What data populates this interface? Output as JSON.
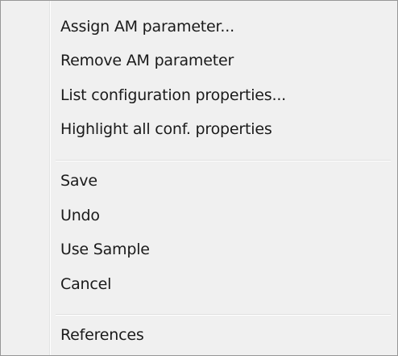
{
  "menu": {
    "groups": [
      {
        "items": [
          {
            "label": "Assign AM parameter..."
          },
          {
            "label": "Remove AM parameter"
          },
          {
            "label": "List configuration properties..."
          },
          {
            "label": "Highlight all conf. properties"
          }
        ]
      },
      {
        "items": [
          {
            "label": "Save"
          },
          {
            "label": "Undo"
          },
          {
            "label": "Use Sample"
          },
          {
            "label": "Cancel"
          }
        ]
      },
      {
        "items": [
          {
            "label": "References"
          }
        ]
      }
    ]
  }
}
